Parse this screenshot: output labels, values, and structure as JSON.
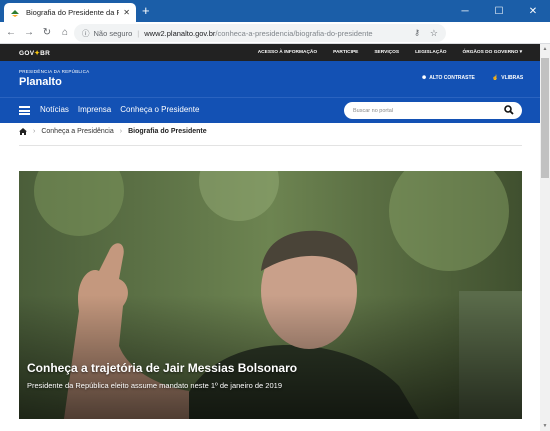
{
  "browser": {
    "tab_title": "Biografia do Presidente da Repú",
    "new_tab": "+",
    "tab_close": "✕",
    "minimize": "─",
    "maximize": "☐",
    "close": "✕",
    "back": "←",
    "forward": "→",
    "reload": "↻",
    "home": "⌂",
    "info_icon": "ⓘ",
    "not_secure": "Não seguro",
    "url_host": "www2.planalto.gov.br",
    "url_path": "/conheca-a-presidencia/biografia-do-presidente",
    "star": "☆",
    "menu": "⋮"
  },
  "govbar": {
    "logo": "GOV",
    "logo_suffix": "BR",
    "links": [
      "ACESSO À INFORMAÇÃO",
      "PARTICIPE",
      "SERVIÇOS",
      "LEGISLAÇÃO",
      "ÓRGÃOS DO GOVERNO"
    ]
  },
  "header": {
    "presidencia": "PRESIDÊNCIA DA REPÚBLICA",
    "site_name": "Planalto",
    "alto_contraste": "ALTO CONTRASTE",
    "vlibras": "VLIBRAS"
  },
  "nav": {
    "items": [
      "Notícias",
      "Imprensa",
      "Conheça o Presidente"
    ],
    "search_placeholder": "Buscar no portal"
  },
  "breadcrumb": {
    "home_icon": "home-icon",
    "items": [
      "Conheça a Presidência",
      "Biografia do Presidente"
    ]
  },
  "hero": {
    "title": "Conheça a trajetória de Jair Messias Bolsonaro",
    "subtitle": "Presidente da República eleito assume mandato neste 1º de janeiro de 2019"
  },
  "colors": {
    "tabstrip": "#1b5ea8",
    "govbar": "#222222",
    "header_blue": "#1351b4"
  }
}
